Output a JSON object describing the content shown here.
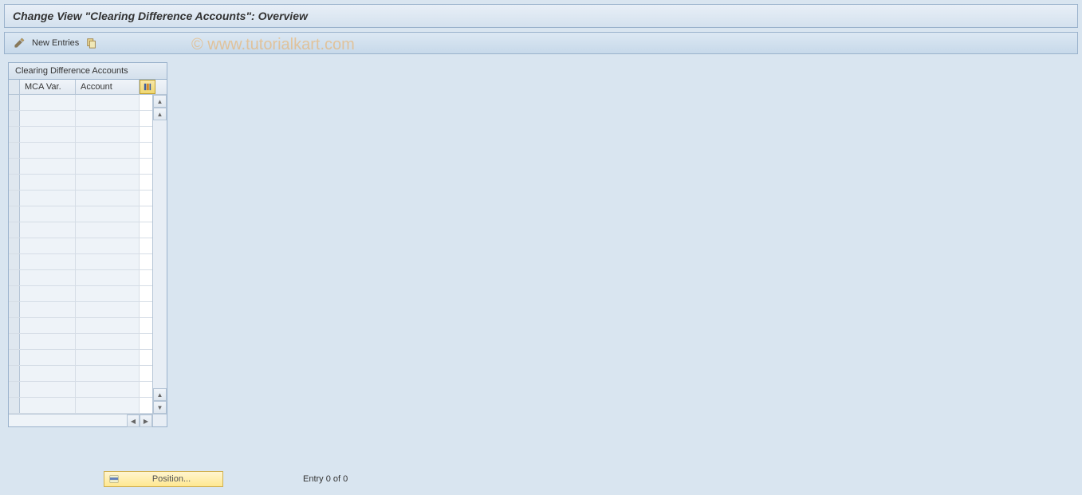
{
  "header": {
    "title": "Change View \"Clearing Difference Accounts\": Overview"
  },
  "toolbar": {
    "new_entries_label": "New Entries"
  },
  "watermark": "© www.tutorialkart.com",
  "table": {
    "title": "Clearing Difference Accounts",
    "columns": {
      "mca_var": "MCA Var.",
      "account": "Account"
    },
    "rows": [
      {
        "mca_var": "",
        "account": ""
      },
      {
        "mca_var": "",
        "account": ""
      },
      {
        "mca_var": "",
        "account": ""
      },
      {
        "mca_var": "",
        "account": ""
      },
      {
        "mca_var": "",
        "account": ""
      },
      {
        "mca_var": "",
        "account": ""
      },
      {
        "mca_var": "",
        "account": ""
      },
      {
        "mca_var": "",
        "account": ""
      },
      {
        "mca_var": "",
        "account": ""
      },
      {
        "mca_var": "",
        "account": ""
      },
      {
        "mca_var": "",
        "account": ""
      },
      {
        "mca_var": "",
        "account": ""
      },
      {
        "mca_var": "",
        "account": ""
      },
      {
        "mca_var": "",
        "account": ""
      },
      {
        "mca_var": "",
        "account": ""
      },
      {
        "mca_var": "",
        "account": ""
      },
      {
        "mca_var": "",
        "account": ""
      },
      {
        "mca_var": "",
        "account": ""
      },
      {
        "mca_var": "",
        "account": ""
      },
      {
        "mca_var": "",
        "account": ""
      }
    ]
  },
  "footer": {
    "position_label": "Position...",
    "entry_text": "Entry 0 of 0"
  }
}
